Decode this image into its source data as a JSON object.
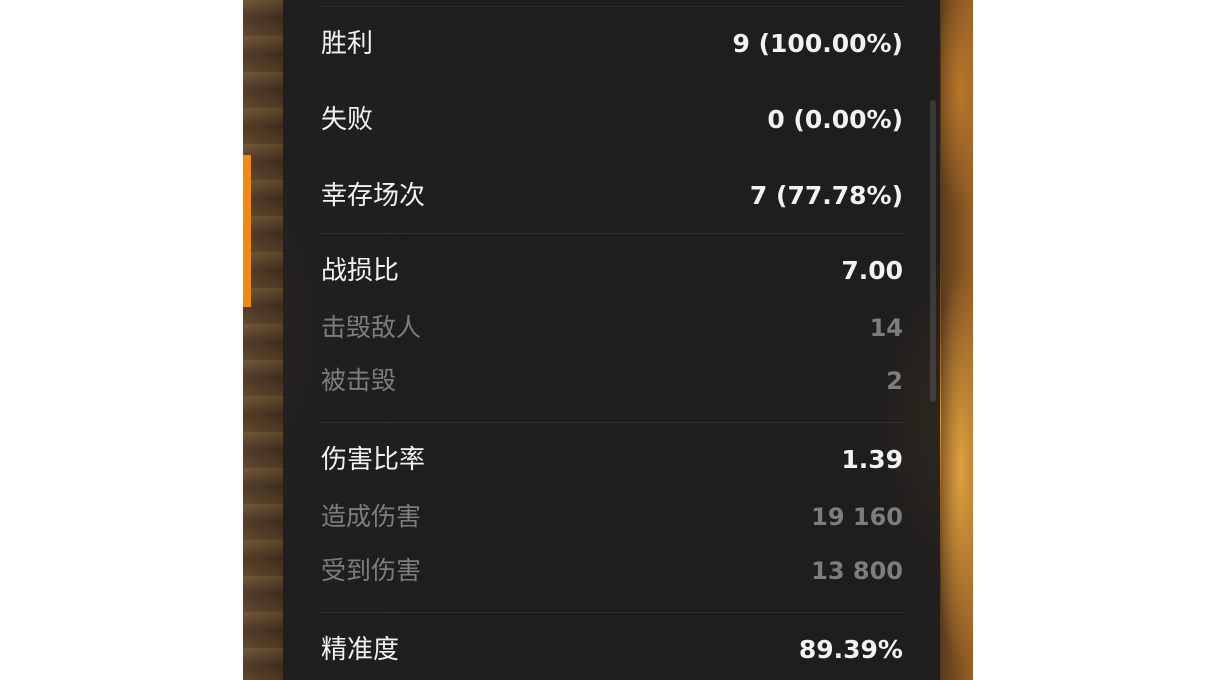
{
  "stats": {
    "victories": {
      "label": "胜利",
      "value": "9 (100.00%)"
    },
    "defeats": {
      "label": "失败",
      "value": "0 (0.00%)"
    },
    "survived": {
      "label": "幸存场次",
      "value": "7 (77.78%)"
    },
    "kd_ratio": {
      "label": "战损比",
      "value": "7.00"
    },
    "destroyed": {
      "label": "击毁敌人",
      "value": "14"
    },
    "killed": {
      "label": "被击毁",
      "value": "2"
    },
    "damage_ratio": {
      "label": "伤害比率",
      "value": "1.39"
    },
    "damage_dealt": {
      "label": "造成伤害",
      "value": "19 160"
    },
    "damage_received": {
      "label": "受到伤害",
      "value": "13 800"
    },
    "accuracy": {
      "label": "精准度",
      "value": "89.39%"
    }
  },
  "colors": {
    "accent": "#f08a12",
    "primary_text": "#f2f2f2",
    "secondary_text": "#7d7d7d",
    "panel_bg": "#1e1e1e"
  }
}
